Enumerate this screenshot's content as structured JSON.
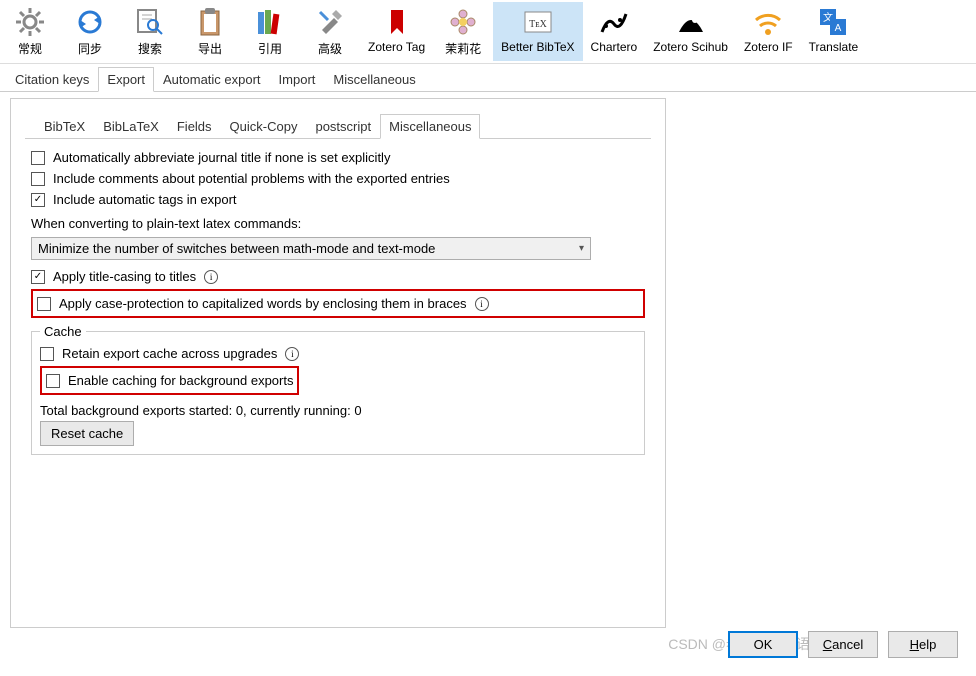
{
  "toolbar": {
    "items": [
      {
        "label": "常规",
        "icon": "gear"
      },
      {
        "label": "同步",
        "icon": "sync"
      },
      {
        "label": "搜索",
        "icon": "search"
      },
      {
        "label": "导出",
        "icon": "clipboard"
      },
      {
        "label": "引用",
        "icon": "books"
      },
      {
        "label": "高级",
        "icon": "tools"
      },
      {
        "label": "Zotero Tag",
        "icon": "bookmark"
      },
      {
        "label": "茉莉花",
        "icon": "flower"
      },
      {
        "label": "Better BibTeX",
        "icon": "tex",
        "selected": true
      },
      {
        "label": "Chartero",
        "icon": "chart"
      },
      {
        "label": "Zotero Scihub",
        "icon": "scihub"
      },
      {
        "label": "Zotero IF",
        "icon": "wifi"
      },
      {
        "label": "Translate",
        "icon": "translate"
      }
    ]
  },
  "tabs": {
    "items": [
      "Citation keys",
      "Export",
      "Automatic export",
      "Import",
      "Miscellaneous"
    ],
    "active": "Export"
  },
  "subtabs": {
    "items": [
      "BibTeX",
      "BibLaTeX",
      "Fields",
      "Quick-Copy",
      "postscript",
      "Miscellaneous"
    ],
    "active": "Miscellaneous"
  },
  "options": {
    "abbrev": {
      "label": "Automatically abbreviate journal title if none is set explicitly",
      "checked": false
    },
    "comments": {
      "label": "Include comments about potential problems with the exported entries",
      "checked": false
    },
    "autotags": {
      "label": "Include automatic tags in export",
      "checked": true
    },
    "convert_label": "When converting to plain-text latex commands:",
    "dropdown": "Minimize the number of switches between math-mode and text-mode",
    "titlecase": {
      "label": "Apply title-casing to titles",
      "checked": true
    },
    "caseprotect": {
      "label": "Apply case-protection to capitalized words by enclosing them in braces",
      "checked": false
    }
  },
  "cache": {
    "legend": "Cache",
    "retain": {
      "label": "Retain export cache across upgrades",
      "checked": false
    },
    "bgexport": {
      "label": "Enable caching for background exports",
      "checked": false
    },
    "status": "Total background exports started: 0, currently running: 0",
    "reset": "Reset cache"
  },
  "buttons": {
    "ok": "OK",
    "cancel": "Cancel",
    "help": "Help"
  },
  "watermark": "CSDN @老师我想当语文课代表"
}
